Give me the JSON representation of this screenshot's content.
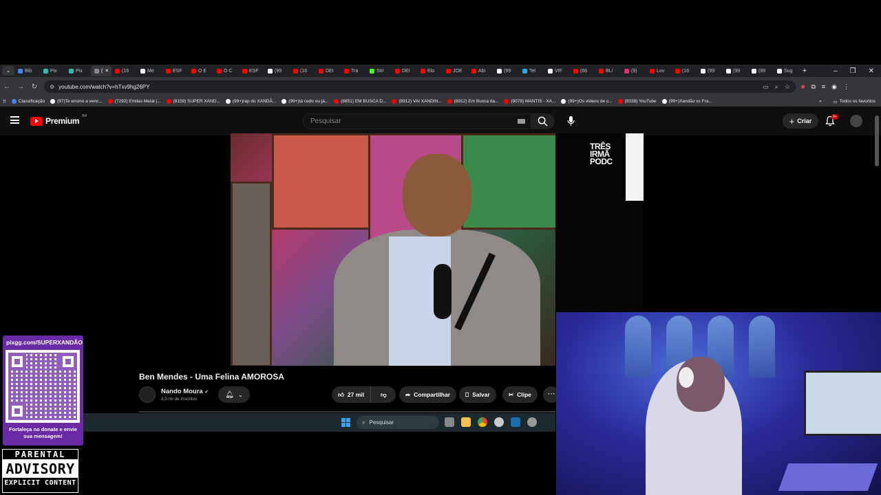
{
  "browser": {
    "tabs": [
      {
        "label": "Bib",
        "color": "#4285f4"
      },
      {
        "label": "Pix",
        "color": "#32bcad"
      },
      {
        "label": "Pix",
        "color": "#32bcad"
      },
      {
        "label": "(",
        "color": "#888888",
        "active": true
      },
      {
        "label": "(16",
        "color": "#ff0000"
      },
      {
        "label": "Me",
        "color": "#ffffff"
      },
      {
        "label": "ESF",
        "color": "#ff0000"
      },
      {
        "label": "O E",
        "color": "#ff0000"
      },
      {
        "label": "O C",
        "color": "#ff0000"
      },
      {
        "label": "ESF",
        "color": "#ff0000"
      },
      {
        "label": "(99",
        "color": "#ffffff"
      },
      {
        "label": "(16",
        "color": "#ff0000"
      },
      {
        "label": "DEI",
        "color": "#ff0000"
      },
      {
        "label": "Tra",
        "color": "#ff0000"
      },
      {
        "label": "Stri",
        "color": "#53fc18"
      },
      {
        "label": "DEI",
        "color": "#ff0000"
      },
      {
        "label": "Elo",
        "color": "#ff0000"
      },
      {
        "label": "JOE",
        "color": "#ff0000"
      },
      {
        "label": "Abi",
        "color": "#ff0000"
      },
      {
        "label": "(99",
        "color": "#ffffff"
      },
      {
        "label": "Tel",
        "color": "#2aabee"
      },
      {
        "label": "VIF",
        "color": "#ffffff"
      },
      {
        "label": "(66",
        "color": "#ff0000"
      },
      {
        "label": "BL/",
        "color": "#ff0000"
      },
      {
        "label": "(9)",
        "color": "#e1306c"
      },
      {
        "label": "Lov",
        "color": "#ff0000"
      },
      {
        "label": "(16",
        "color": "#ff0000"
      },
      {
        "label": "(99",
        "color": "#ffffff"
      },
      {
        "label": "(99",
        "color": "#ffffff"
      },
      {
        "label": "(99",
        "color": "#ffffff"
      },
      {
        "label": "Sug",
        "color": "#ffffff"
      }
    ],
    "url": "youtube.com/watch?v=hTxv9hg26PY",
    "bookmarks": [
      {
        "label": "Classificação",
        "color": "#4285f4"
      },
      {
        "label": "(97)Te ensino a venc...",
        "color": "#ffffff"
      },
      {
        "label": "(7292) Emilas Metal |...",
        "color": "#ff0000"
      },
      {
        "label": "(8159) SUPER XAND...",
        "color": "#ff0000"
      },
      {
        "label": "(99+)rap do XANDÃ...",
        "color": "#ffffff"
      },
      {
        "label": "(99+)tá cedo ou já...",
        "color": "#ffffff"
      },
      {
        "label": "(8851) EM BUSCA D...",
        "color": "#ff0000"
      },
      {
        "label": "(8912) VAI XANDIN...",
        "color": "#ff0000"
      },
      {
        "label": "(8912) Em Busca da...",
        "color": "#ff0000"
      },
      {
        "label": "(9078) MANTIS - XA...",
        "color": "#ff0000"
      },
      {
        "label": "(99+)Os vídeos de c...",
        "color": "#ffffff"
      },
      {
        "label": "(9338) YouTube",
        "color": "#ff0000"
      },
      {
        "label": "(99+)Xandão vs Fra...",
        "color": "#ffffff"
      }
    ],
    "all_bookmarks": "Todos os favoritos"
  },
  "youtube": {
    "brand": "Premium",
    "region": "BR",
    "search_placeholder": "Pesquisar",
    "create_label": "Criar",
    "notif_badge": "9+",
    "side_logo_lines": [
      "TRÊS",
      "IRMÃ",
      "PODC"
    ]
  },
  "video": {
    "title": "Ben Mendes - Uma Felina AMOROSA",
    "channel": "Nando Moura",
    "subscribers": "3,5 mi de inscritos",
    "likes": "27 mil",
    "share_label": "Compartilhar",
    "save_label": "Salvar",
    "clip_label": "Clipe",
    "more_label": "⋯"
  },
  "taskbar": {
    "search_placeholder": "Pesquisar"
  },
  "overlay": {
    "qr_url": "pixgg.com/SUPERXANDÃO",
    "qr_message": "Fortaleça no donate e envie sua mensagem!",
    "advisory_top": "PARENTAL",
    "advisory_mid": "ADVISORY",
    "advisory_bot": "EXPLICIT CONTENT"
  },
  "colors": {
    "yt_red": "#ff0000",
    "qr_purple": "#6b2aa5",
    "chrome_dark": "#202124"
  }
}
